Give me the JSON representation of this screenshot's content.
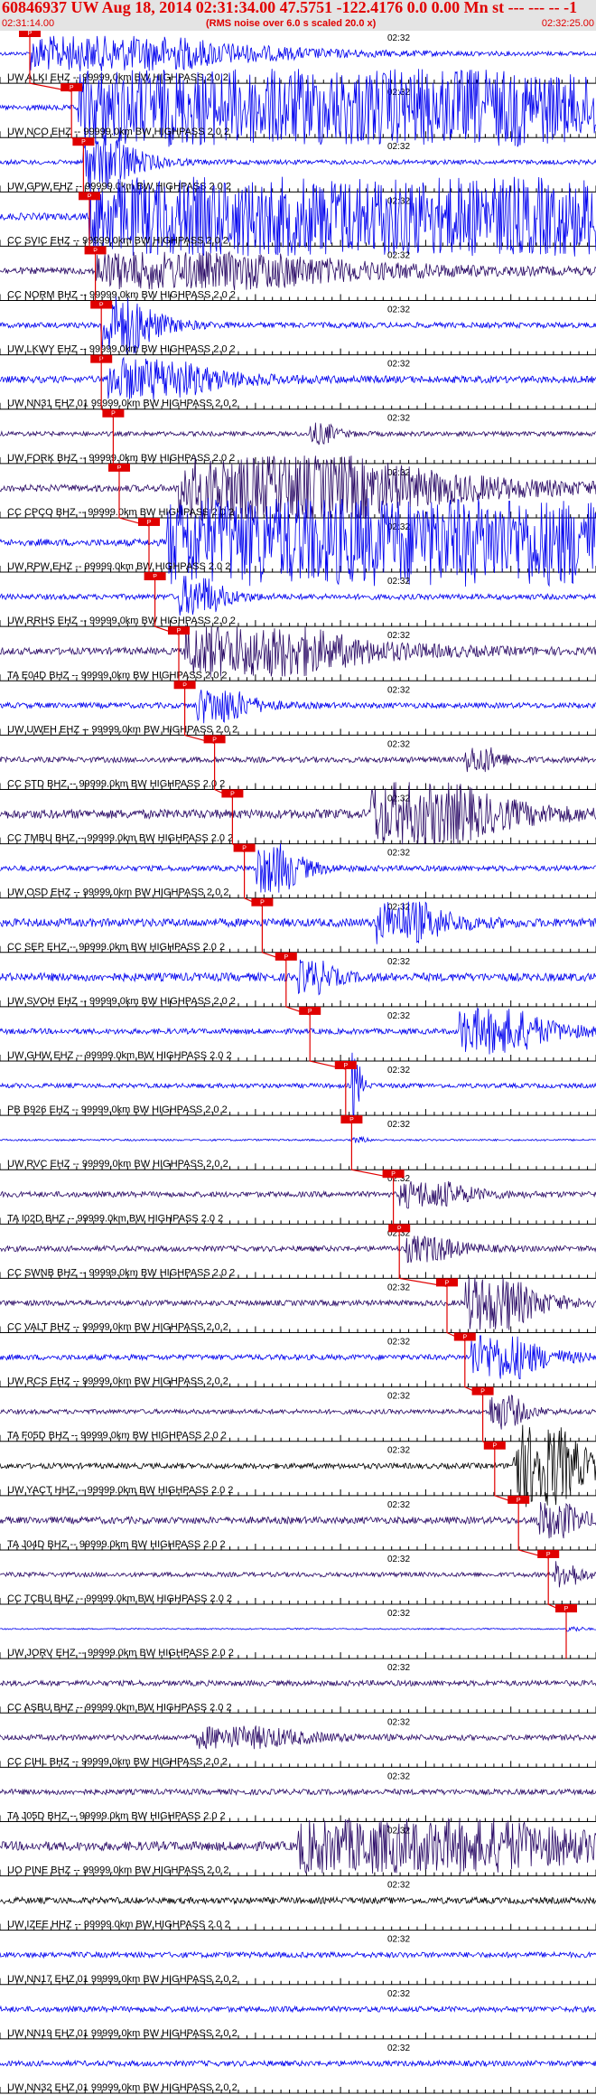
{
  "header": {
    "title": "60846937 UW Aug 18, 2014 02:31:34.00   47.5751 -122.4176  0.0 0.00 Mn st --- --- --  -1",
    "start_time": "02:31:14.00",
    "note": "(RMS noise over 6.0 s scaled 20.0 x)",
    "end_time": "02:32:25.00"
  },
  "chart_data": {
    "type": "line",
    "x_start": "02:31:14.00",
    "x_end": "02:32:25.00",
    "mid_tick_label": "02:32",
    "pick_label": "P",
    "colors": {
      "blue": "#0000ee",
      "purple": "#2a0a66",
      "black": "#000000",
      "pick": "#e00000",
      "header_bg": "#e4e4e4"
    },
    "traces": [
      {
        "label": "UW ALKI EHZ -- 99999.0km BW  HIGHPASS  2.0  2",
        "color": "blue",
        "pick": 0.05,
        "amp": 0.08,
        "burst": [
          0.05,
          0.25,
          0.7
        ]
      },
      {
        "label": "UW NCO EHZ -- 99999.0km BW  HIGHPASS  2.0  2",
        "color": "blue",
        "pick": 0.12,
        "amp": 0.12,
        "burst": [
          0.13,
          0.75,
          1.6
        ]
      },
      {
        "label": "UW GPW EHZ -- 99999.0km BW  HIGHPASS  2.0  2",
        "color": "blue",
        "pick": 0.14,
        "amp": 0.1,
        "burst": [
          0.14,
          0.06,
          1.1
        ]
      },
      {
        "label": "CC SVIC EHZ -- 99999.0km BW  HIGHPASS  2.0  2",
        "color": "blue",
        "pick": 0.15,
        "amp": 0.15,
        "burst": [
          0.15,
          0.85,
          1.6
        ]
      },
      {
        "label": "CC NORM BHZ -- 99999.0km BW  HIGHPASS  2.0  2",
        "color": "purple",
        "pick": 0.16,
        "amp": 0.15,
        "burst": [
          0.16,
          0.3,
          0.7
        ]
      },
      {
        "label": "UW LKWY EHZ -- 99999.0km BW  HIGHPASS  2.0  2",
        "color": "blue",
        "pick": 0.17,
        "amp": 0.12,
        "burst": [
          0.17,
          0.06,
          1.2
        ]
      },
      {
        "label": "UW NN31 EHZ 01 99999.0km BW  HIGHPASS  2.0  2",
        "color": "blue",
        "pick": 0.17,
        "amp": 0.15,
        "burst": [
          0.18,
          0.12,
          0.8
        ]
      },
      {
        "label": "UW FORK BHZ -- 99999.0km BW  HIGHPASS  2.0  2",
        "color": "purple",
        "pick": 0.19,
        "amp": 0.1,
        "burst": [
          0.52,
          0.03,
          0.4
        ]
      },
      {
        "label": "CC CPCO BHZ -- 99999.0km BW  HIGHPASS  2.0  2",
        "color": "purple",
        "pick": 0.2,
        "amp": 0.15,
        "burst": [
          0.3,
          0.3,
          1.3
        ]
      },
      {
        "label": "UW RPW EHZ -- 99999.0km BW  HIGHPASS  2.0  2",
        "color": "blue",
        "pick": 0.25,
        "amp": 0.15,
        "burst": [
          0.28,
          0.72,
          1.8
        ]
      },
      {
        "label": "UW RRHS EHZ -- 99999.0km BW  HIGHPASS  2.0  2",
        "color": "blue",
        "pick": 0.26,
        "amp": 0.12,
        "burst": [
          0.3,
          0.05,
          0.8
        ]
      },
      {
        "label": "TA E04D BHZ -- 99999.0km BW  HIGHPASS  2.0  2",
        "color": "purple",
        "pick": 0.3,
        "amp": 0.15,
        "burst": [
          0.31,
          0.2,
          1.0
        ]
      },
      {
        "label": "UW UWEH EHZ -- 99999.0km BW  HIGHPASS  2.0  2",
        "color": "blue",
        "pick": 0.31,
        "amp": 0.12,
        "burst": [
          0.33,
          0.06,
          0.7
        ]
      },
      {
        "label": "CC STD BHZ -- 99999.0km BW  HIGHPASS  2.0  2",
        "color": "purple",
        "pick": 0.36,
        "amp": 0.12,
        "burst": [
          0.78,
          0.04,
          0.5
        ]
      },
      {
        "label": "CC TMBU BHZ -- 99999.0km BW  HIGHPASS  2.0  2",
        "color": "purple",
        "pick": 0.39,
        "amp": 0.2,
        "burst": [
          0.62,
          0.15,
          1.2
        ]
      },
      {
        "label": "UW OSD EHZ -- 99999.0km BW  HIGHPASS  2.0  2",
        "color": "blue",
        "pick": 0.41,
        "amp": 0.12,
        "burst": [
          0.43,
          0.05,
          1.0
        ]
      },
      {
        "label": "CC SEP EHZ -- 99999.0km BW  HIGHPASS  2.0  2",
        "color": "blue",
        "pick": 0.44,
        "amp": 0.18,
        "burst": [
          0.63,
          0.08,
          0.8
        ]
      },
      {
        "label": "UW SVOH EHZ -- 99999.0km BW  HIGHPASS  2.0  2",
        "color": "blue",
        "pick": 0.48,
        "amp": 0.18,
        "burst": [
          0.5,
          0.04,
          0.6
        ]
      },
      {
        "label": "UW GHW EHZ -- 99999.0km BW  HIGHPASS  2.0  2",
        "color": "blue",
        "pick": 0.52,
        "amp": 0.12,
        "burst": [
          0.77,
          0.1,
          0.9
        ]
      },
      {
        "label": "PB B926 EHZ -- 99999.0km BW  HIGHPASS  2.0  2",
        "color": "blue",
        "pick": 0.58,
        "amp": 0.1,
        "burst": [
          0.59,
          0.01,
          1.4
        ]
      },
      {
        "label": "UW RVC EHZ -- 99999.0km BW  HIGHPASS  2.0  2",
        "color": "blue",
        "pick": 0.59,
        "amp": 0.04,
        "burst": [
          0.59,
          0.02,
          0.1
        ]
      },
      {
        "label": "TA I02D BHZ -- 99999.0km BW  HIGHPASS  2.0  2",
        "color": "purple",
        "pick": 0.66,
        "amp": 0.12,
        "burst": [
          0.67,
          0.08,
          0.5
        ]
      },
      {
        "label": "CC SWNB BHZ -- 99999.0km BW  HIGHPASS  2.0  2",
        "color": "purple",
        "pick": 0.67,
        "amp": 0.12,
        "burst": [
          0.68,
          0.06,
          0.5
        ]
      },
      {
        "label": "CC VALT BHZ -- 99999.0km BW  HIGHPASS  2.0  2",
        "color": "purple",
        "pick": 0.75,
        "amp": 0.12,
        "burst": [
          0.78,
          0.08,
          1.1
        ]
      },
      {
        "label": "UW RCS EHZ -- 99999.0km BW  HIGHPASS  2.0  2",
        "color": "blue",
        "pick": 0.78,
        "amp": 0.12,
        "burst": [
          0.79,
          0.08,
          0.9
        ]
      },
      {
        "label": "TA F05D BHZ -- 99999.0km BW  HIGHPASS  2.0  2",
        "color": "purple",
        "pick": 0.81,
        "amp": 0.1,
        "burst": [
          0.82,
          0.04,
          0.7
        ]
      },
      {
        "label": "UW YACT HHZ -- 99999.0km BW  HIGHPASS  2.0  2",
        "color": "black",
        "pick": 0.83,
        "amp": 0.12,
        "burst": [
          0.86,
          0.08,
          1.7
        ]
      },
      {
        "label": "TA J04D BHZ -- 99999.0km BW  HIGHPASS  2.0  2",
        "color": "purple",
        "pick": 0.87,
        "amp": 0.15,
        "burst": [
          0.9,
          0.05,
          0.7
        ]
      },
      {
        "label": "CC TCBU BHZ -- 99999.0km BW  HIGHPASS  2.0  2",
        "color": "purple",
        "pick": 0.92,
        "amp": 0.1,
        "burst": [
          0.93,
          0.03,
          0.5
        ]
      },
      {
        "label": "UW JORV EHZ -- 99999.0km BW  HIGHPASS  2.0  2",
        "color": "blue",
        "pick": 0.95,
        "amp": 0.03,
        "burst": [
          0.95,
          0.02,
          0.1
        ]
      },
      {
        "label": "CC ASBU BHZ -- 99999.0km BW  HIGHPASS  2.0  2",
        "color": "purple",
        "pick": null,
        "amp": 0.12,
        "burst": null
      },
      {
        "label": "CC CIHL BHZ -- 99999.0km BW  HIGHPASS  2.0  2",
        "color": "purple",
        "pick": null,
        "amp": 0.12,
        "burst": [
          0.33,
          0.12,
          0.4
        ]
      },
      {
        "label": "TA J05D BHZ -- 99999.0km BW  HIGHPASS  2.0  2",
        "color": "purple",
        "pick": null,
        "amp": 0.12,
        "burst": null
      },
      {
        "label": "UO PINE BHZ -- 99999.0km BW  HIGHPASS  2.0  2",
        "color": "purple",
        "pick": null,
        "amp": 0.2,
        "burst": [
          0.5,
          0.35,
          1.0
        ]
      },
      {
        "label": "UW IZEE HHZ -- 99999.0km BW  HIGHPASS  2.0  2",
        "color": "black",
        "pick": null,
        "amp": 0.14,
        "burst": null
      },
      {
        "label": "UW NN17 EHZ 01 99999.0km BW  HIGHPASS  2.0  2",
        "color": "blue",
        "pick": null,
        "amp": 0.12,
        "burst": null
      },
      {
        "label": "UW NN19 EHZ 01 99999.0km BW  HIGHPASS  2.0  2",
        "color": "blue",
        "pick": null,
        "amp": 0.12,
        "burst": null
      },
      {
        "label": "UW NN32 EHZ 01 99999.0km BW  HIGHPASS  2.0  2",
        "color": "blue",
        "pick": null,
        "amp": 0.12,
        "burst": null
      }
    ]
  }
}
